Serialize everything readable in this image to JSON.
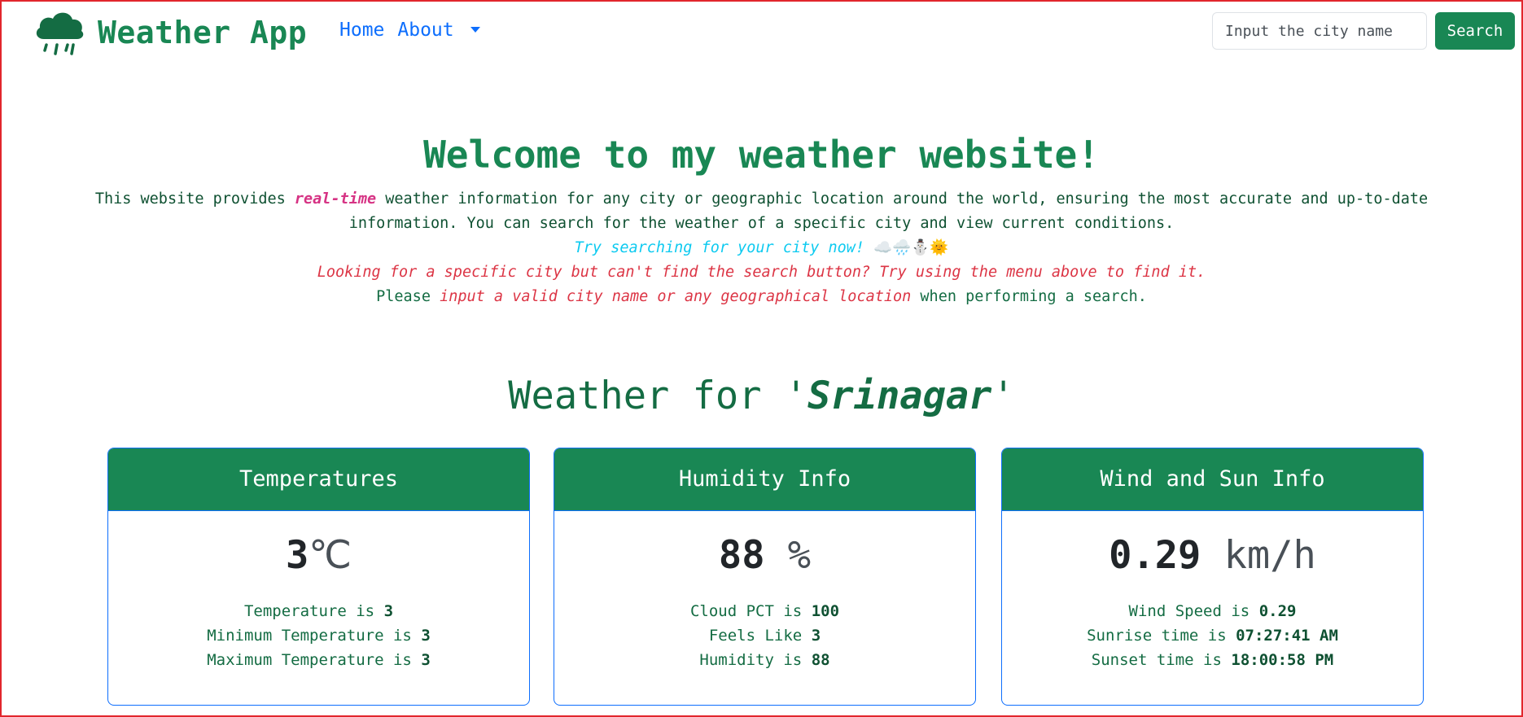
{
  "navbar": {
    "brand": "Weather App",
    "brand_icon": "cloud-rain-icon",
    "links": [
      "Home",
      "About"
    ],
    "search_placeholder": "Input the city name",
    "search_button": "Search"
  },
  "colors": {
    "primary_green": "#198754",
    "dark_green": "#146c43",
    "link_blue": "#0d6efd",
    "accent_red": "#dc3545",
    "accent_cyan": "#0dcaf0",
    "page_border": "#e1262c"
  },
  "hero": {
    "title": "Welcome to my weather website!",
    "desc_pre": "This website provides ",
    "desc_em": "real-time",
    "desc_post": " weather information for any city or geographic location around the world, ensuring the most accurate and up-to-date information. You can search for the weather of a specific city and view current conditions.",
    "try_text": "Try searching for your city now!",
    "try_emoji": "☁️🌧️⛄🌞",
    "hint_text": "Looking for a specific city but can't find the search button? Try using the menu above to find it.",
    "please_pre": "Please ",
    "please_em": "input a valid city name or any geographical location",
    "please_post": " when performing a search."
  },
  "weather": {
    "heading_pre": "Weather for '",
    "city": "Srinagar",
    "heading_post": "'"
  },
  "cards": {
    "temperatures": {
      "title": "Temperatures",
      "big_value": "3",
      "big_unit": "℃",
      "line1_label": "Temperature is ",
      "line1_value": "3",
      "line2_label": "Minimum Temperature is ",
      "line2_value": "3",
      "line3_label": "Maximum Temperature is ",
      "line3_value": "3"
    },
    "humidity": {
      "title": "Humidity Info",
      "big_value": "88",
      "big_unit": " %",
      "line1_label": "Cloud PCT is ",
      "line1_value": "100",
      "line2_label": "Feels Like ",
      "line2_value": "3",
      "line3_label": "Humidity is ",
      "line3_value": "88"
    },
    "wind": {
      "title": "Wind and Sun Info",
      "big_value": "0.29",
      "big_unit": " km/h",
      "line1_label": "Wind Speed is ",
      "line1_value": "0.29",
      "line2_label": "Sunrise time is ",
      "line2_value": "07:27:41 AM",
      "line3_label": "Sunset time is ",
      "line3_value": "18:00:58 PM"
    }
  }
}
